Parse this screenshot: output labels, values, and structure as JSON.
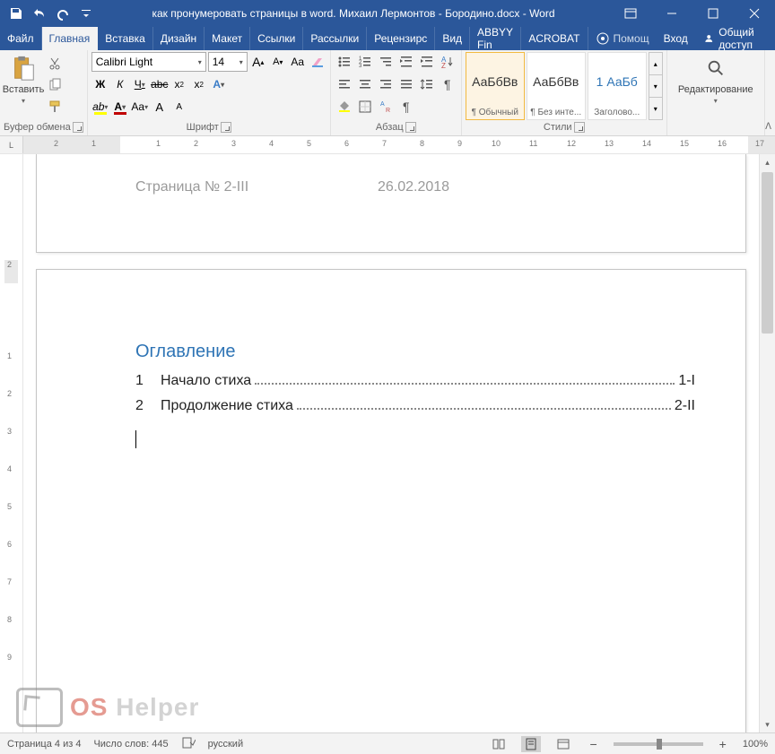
{
  "titlebar": {
    "title": "как пронумеровать страницы в word. Михаил Лермонтов - Бородино.docx - Word"
  },
  "tabs": {
    "file": "Файл",
    "home": "Главная",
    "insert": "Вставка",
    "design": "Дизайн",
    "layout": "Макет",
    "references": "Ссылки",
    "mailings": "Рассылки",
    "review": "Рецензирс",
    "view": "Вид",
    "abbyy": "ABBYY Fin",
    "acrobat": "ACROBAT",
    "tell": "Помощ",
    "signin": "Вход",
    "share": "Общий доступ"
  },
  "ribbon": {
    "clipboard": {
      "label": "Буфер обмена",
      "paste": "Вставить"
    },
    "font": {
      "label": "Шрифт",
      "name": "Calibri Light",
      "size": "14",
      "bold": "Ж",
      "italic": "К",
      "underline": "Ч",
      "strike": "abc",
      "sub": "x",
      "sup": "x",
      "aa": "Aa",
      "bigA": "A",
      "smallA": "A"
    },
    "paragraph": {
      "label": "Абзац"
    },
    "styles": {
      "label": "Стили",
      "items": [
        {
          "preview": "АаБбВв",
          "name": "¶ Обычный"
        },
        {
          "preview": "АаБбВв",
          "name": "¶ Без инте..."
        },
        {
          "preview": "1 АаБб",
          "name": "Заголово..."
        }
      ]
    },
    "editing": {
      "label": "Редактирование"
    }
  },
  "document": {
    "header": {
      "page_label": "Страница № 2-III",
      "date": "26.02.2018"
    },
    "toc": {
      "title": "Оглавление",
      "items": [
        {
          "num": "1",
          "text": "Начало стиха",
          "page": "1-I"
        },
        {
          "num": "2",
          "text": "Продолжение стиха",
          "page": "2-II"
        }
      ]
    }
  },
  "statusbar": {
    "page": "Страница 4 из 4",
    "words": "Число слов: 445",
    "lang": "русский",
    "zoom": "100%"
  },
  "watermark": {
    "os": "OS",
    "helper": "Helper"
  }
}
